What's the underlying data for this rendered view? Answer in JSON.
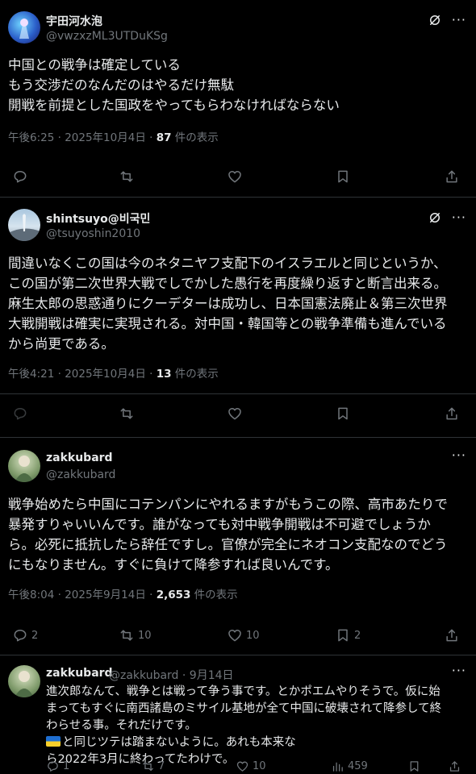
{
  "posts": [
    {
      "name": "宇田河水泡",
      "handle": "@vwzxzML3UTDuKSg",
      "lines": [
        "中国との戦争は確定している",
        "もう交渉だのなんだのはやるだけ無駄",
        "開戦を前提とした国政をやってもらわなければならない"
      ],
      "time": "午後6:25 · 2025年10月4日 · ",
      "views": "87",
      "views_suffix": " 件の表示"
    },
    {
      "name": "shintsuyo@비국민",
      "handle": "@tsuyoshin2010",
      "lines": [
        "間違いなくこの国は今のネタニヤフ支配下のイスラエルと同じというか、",
        "この国が第二次世界大戦でしでかした愚行を再度繰り返すと断言出来る。",
        "麻生太郎の思惑通りにクーデターは成功し、日本国憲法廃止＆第三次世界",
        "大戦開戦は確実に実現される。対中国・韓国等との戦争準備も進んでいる",
        "から尚更である。"
      ],
      "time": "午後4:21 · 2025年10月4日 · ",
      "views": "13",
      "views_suffix": " 件の表示"
    },
    {
      "name": "zakkubard",
      "handle": "@zakkubard",
      "lines": [
        "戦争始めたら中国にコテンパンにやれるますがもうこの際、高市あたりで",
        "暴発すりゃいいんです。誰がなっても対中戦争開戦は不可避でしょうか",
        "ら。必死に抵抗したら辞任ですし。官僚が完全にネオコン支配なのでどう",
        "にもなりません。すぐに負けて降参すれば良いんです。"
      ],
      "time": "午後8:04 · 2025年9月14日 · ",
      "views": "2,653",
      "views_suffix": " 件の表示",
      "counts": {
        "reply": "2",
        "retweet": "10",
        "like": "10",
        "bookmark": "2"
      }
    }
  ],
  "reply": {
    "name": "zakkubard",
    "handle_date": "@zakkubard · 9月14日",
    "lines": [
      "進次郎なんて、戦争とは戦って争う事です。とかポエムやりそうで。仮に始",
      "まってもすぐに南西諸島のミサイル基地が全て中国に破壊されて降参して終",
      "わらせる事。それだけです。",
      "と同じツテは踏まないように。あれも本来な",
      "ら2022年3月に終わってたわけで。"
    ],
    "counts": {
      "reply": "1",
      "retweet": "7",
      "like": "10",
      "views": "459"
    }
  },
  "colors": {
    "background": "#000000",
    "text": "#e7e9ea",
    "muted": "#71767b",
    "separator": "#2f3336"
  }
}
